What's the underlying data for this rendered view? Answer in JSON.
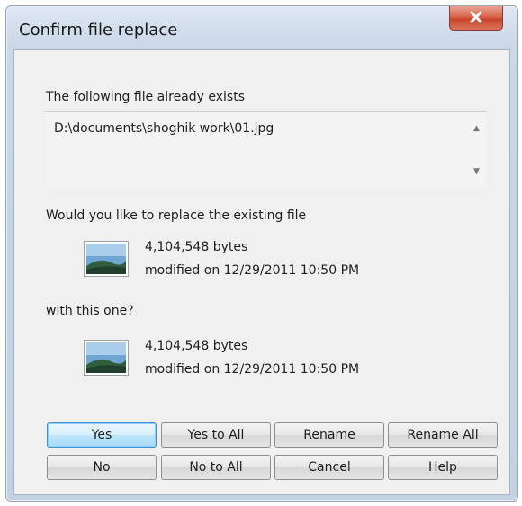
{
  "window": {
    "title": "Confirm file replace"
  },
  "message": {
    "exists_label": "The following file already exists",
    "path": "D:\\documents\\shoghik work\\01.jpg",
    "replace_question": "Would you like to replace the existing file",
    "with_label": "with this one?"
  },
  "existing_file": {
    "size": "4,104,548 bytes",
    "modified": "modified on 12/29/2011 10:50 PM"
  },
  "new_file": {
    "size": "4,104,548 bytes",
    "modified": "modified on 12/29/2011 10:50 PM"
  },
  "buttons": {
    "row1": [
      "Yes",
      "Yes to All",
      "Rename",
      "Rename All"
    ],
    "row2": [
      "No",
      "No to All",
      "Cancel",
      "Help"
    ]
  },
  "icons": {
    "close": "close-icon",
    "file_thumbnail": "image-file-icon",
    "scroll_up": "scroll-up-arrow-icon",
    "scroll_down": "scroll-down-arrow-icon"
  }
}
